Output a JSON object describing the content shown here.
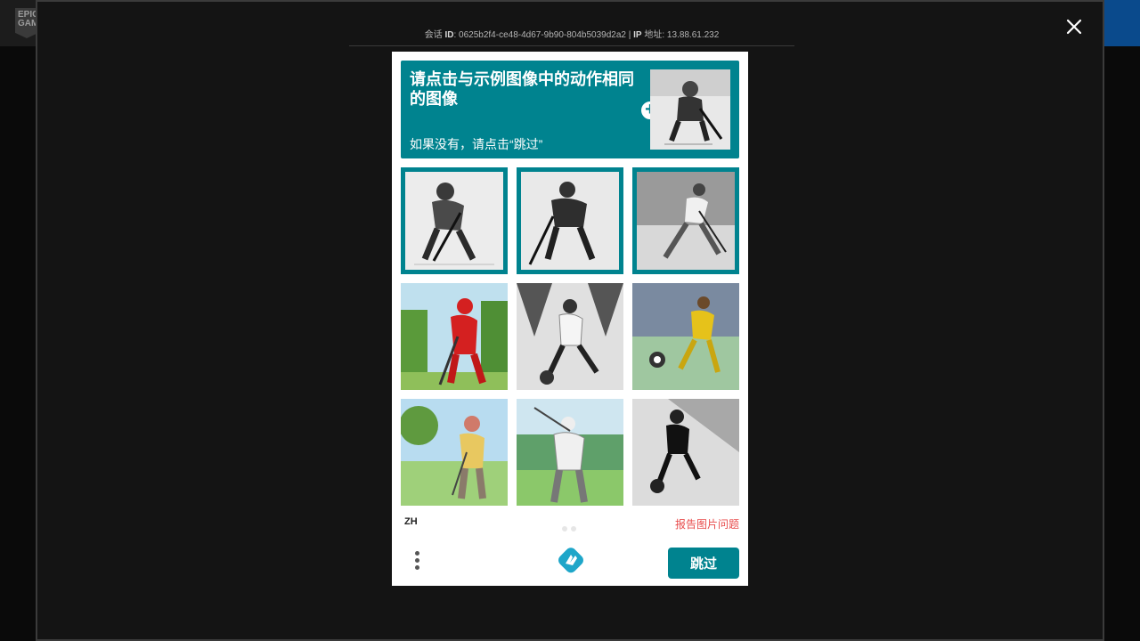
{
  "background": {
    "logo_text": "EPIC GAMES"
  },
  "overlay": {
    "session": {
      "id_prefix": "会话",
      "id_label": "ID",
      "id_value": ": 0625b2f4-ce48-4d67-9b90-804b5039d2a2 | ",
      "ip_label": "IP",
      "ip_suffix": " 地址: 13.88.61.232"
    },
    "close_icon": "close-icon"
  },
  "captcha": {
    "prompt_title": "请点击与示例图像中的动作相同的图像",
    "prompt_sub": "如果没有，请点击“跳过”",
    "tiles": [
      {
        "desc": "hockey player skating",
        "selected": true
      },
      {
        "desc": "hockey player with stick",
        "selected": true
      },
      {
        "desc": "hockey player sketch",
        "selected": true
      },
      {
        "desc": "hockey player in red",
        "selected": false
      },
      {
        "desc": "soccer player kicking ball",
        "selected": false
      },
      {
        "desc": "soccer player in yellow",
        "selected": false
      },
      {
        "desc": "golfer standing",
        "selected": false
      },
      {
        "desc": "golfer swinging",
        "selected": false
      },
      {
        "desc": "soccer player dribbling",
        "selected": false
      }
    ],
    "language": "ZH",
    "report_label": "报告图片问题",
    "submit_label": "跳过",
    "colors": {
      "accent": "#00838f",
      "report": "#e84b4b"
    }
  }
}
